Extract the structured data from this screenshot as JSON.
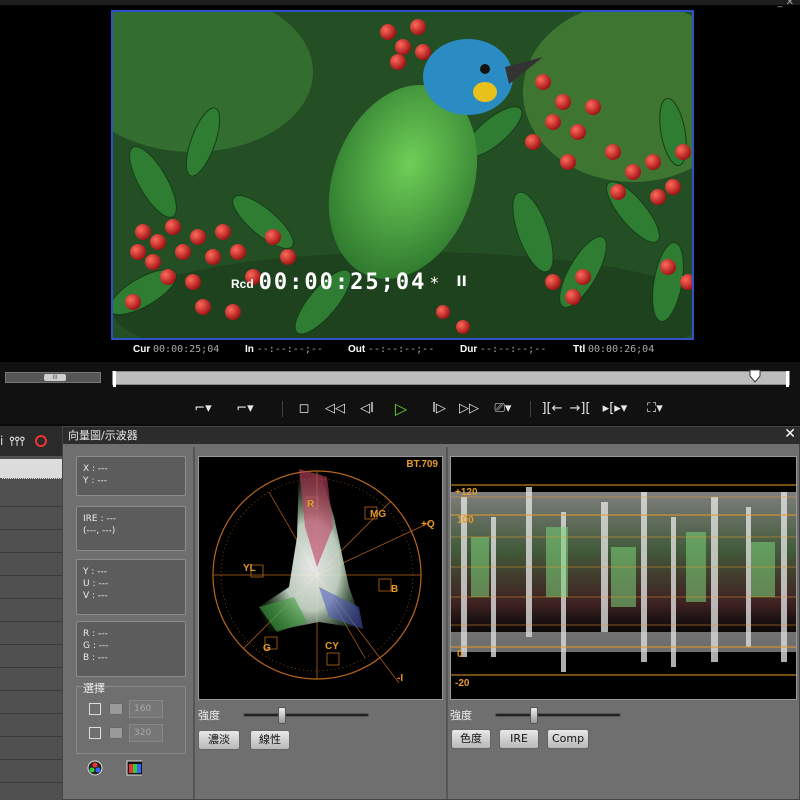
{
  "player": {
    "window_controls": "_ ✕",
    "overlay": {
      "label": "Rcd",
      "timecode": "00:00:25;04",
      "star": "*",
      "state": "II"
    },
    "timecodes": [
      {
        "label": "Cur",
        "value": "00:00:25;04"
      },
      {
        "label": "In",
        "value": "--:--:--;--"
      },
      {
        "label": "Out",
        "value": "--:--:--;--"
      },
      {
        "label": "Dur",
        "value": "--:--:--;--"
      },
      {
        "label": "Ttl",
        "value": "00:00:26;04"
      }
    ],
    "scrub_thumb": "III",
    "timeline_position": 0.955
  },
  "transport": {
    "buttons": [
      {
        "name": "mark-in-button",
        "glyph": "⌐▾"
      },
      {
        "name": "mark-out-button",
        "glyph": "⌐▾"
      },
      {
        "name": "stop-button",
        "glyph": "◻"
      },
      {
        "name": "rewind-button",
        "glyph": "◁◁"
      },
      {
        "name": "step-back-button",
        "glyph": "◁I"
      },
      {
        "name": "play-button",
        "glyph": "▷"
      },
      {
        "name": "step-forward-button",
        "glyph": "I▷"
      },
      {
        "name": "fast-forward-button",
        "glyph": "▷▷"
      },
      {
        "name": "loop-button",
        "glyph": "⎚▾"
      },
      {
        "name": "prev-edit-button",
        "glyph": "][←"
      },
      {
        "name": "next-edit-button",
        "glyph": "→]["
      },
      {
        "name": "match-frame-button",
        "glyph": "▸[▸▾"
      },
      {
        "name": "export-button",
        "glyph": "⛶▾"
      }
    ]
  },
  "left_panel": {
    "head_text": "i",
    "mixer_icon": "⫯⫯⫯"
  },
  "dialog": {
    "title": "向量圖/示波器",
    "close": "✕",
    "info": {
      "xy": [
        "X : ---",
        "Y : ---"
      ],
      "ire": [
        "IRE : ---",
        " (---, ---)"
      ],
      "yuv": [
        "Y : ---",
        "U : ---",
        "V : ---"
      ],
      "rgb": [
        "R : ---",
        "G : ---",
        "B : ---"
      ]
    },
    "select": {
      "title": "選擇",
      "rows": [
        {
          "value": "160"
        },
        {
          "value": "320"
        }
      ]
    },
    "vectorscope": {
      "standard": "BT.709",
      "targets": [
        "R",
        "MG",
        "B",
        "CY",
        "G",
        "YL"
      ],
      "axes": [
        "+Q",
        "-I"
      ],
      "slider_label": "強度",
      "intensity": 0.3,
      "buttons": [
        "濃淡",
        "線性"
      ]
    },
    "waveform": {
      "labels": [
        "+120",
        "100",
        "0",
        "-20"
      ],
      "slider_label": "強度",
      "intensity": 0.3,
      "buttons": [
        "色度",
        "IRE",
        "Comp"
      ]
    }
  },
  "colors": {
    "accent_orange": "#e59a2a",
    "play_green": "#6bd22a",
    "video_border": "#2c52c8"
  }
}
